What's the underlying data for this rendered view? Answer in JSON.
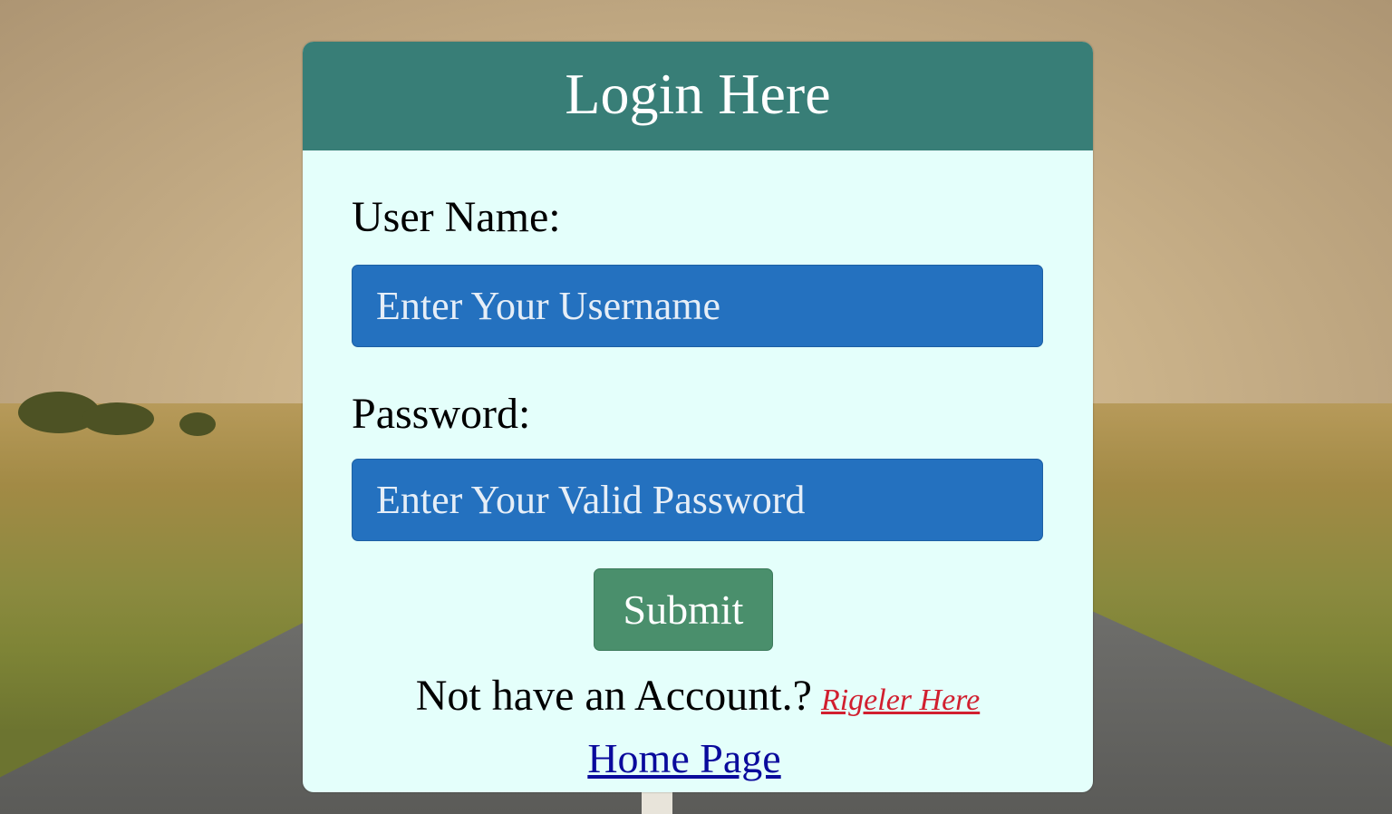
{
  "login": {
    "title": "Login Here",
    "username_label": "User Name:",
    "username_placeholder": "Enter Your Username",
    "password_label": "Password:",
    "password_placeholder": "Enter Your Valid Password",
    "submit_label": "Submit",
    "account_prompt": "Not have an Account.?",
    "register_link": "Rigeler Here",
    "home_link": "Home Page"
  },
  "colors": {
    "header_bg": "#387e77",
    "card_bg": "#e4fffb",
    "input_bg": "#2471bf",
    "submit_bg": "#4a8f6c",
    "register_link": "#d11f2f",
    "home_link": "#0a0a9c"
  }
}
